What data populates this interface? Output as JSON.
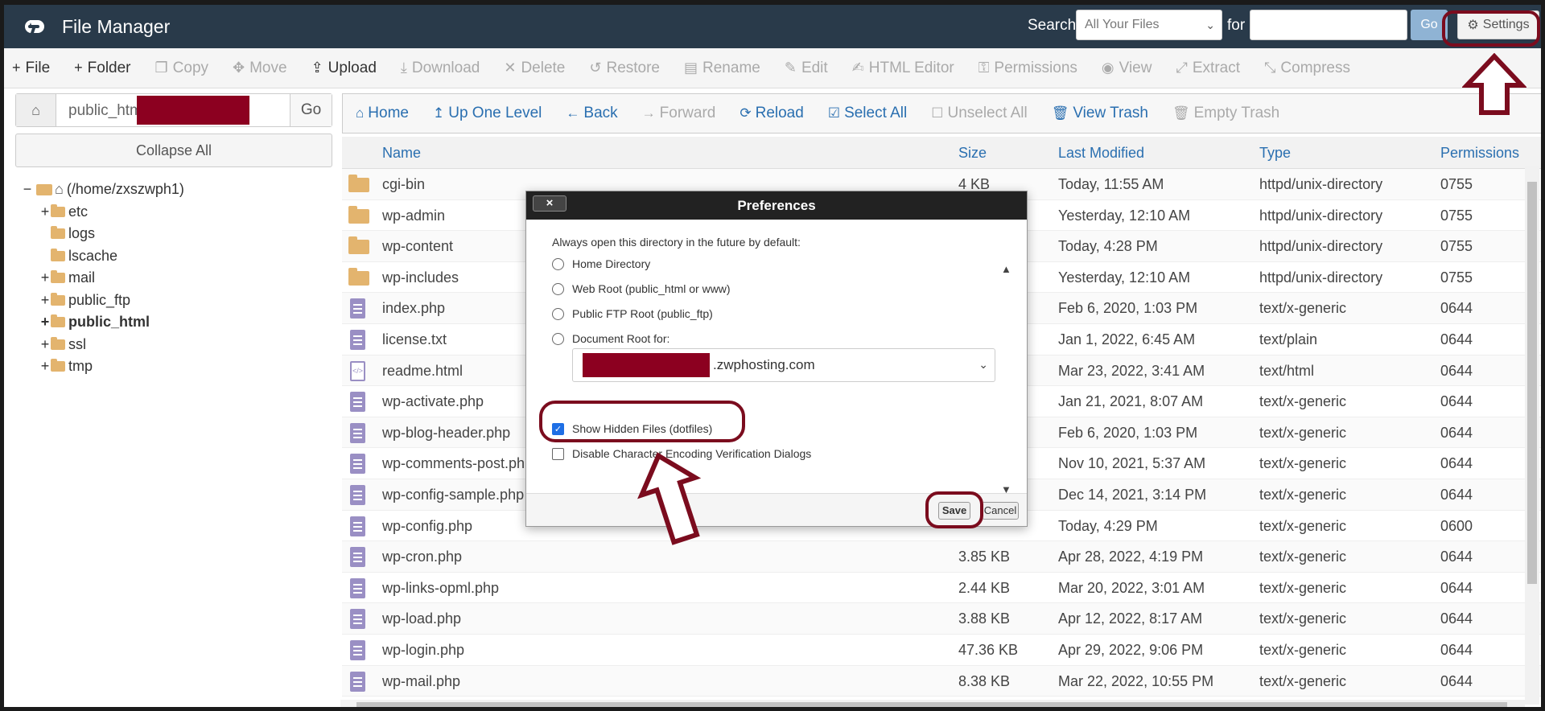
{
  "header": {
    "app_title": "File Manager",
    "search_label": "Search",
    "search_scope": "All Your Files",
    "for_label": "for",
    "search_value": "",
    "go_label": "Go",
    "settings_label": "Settings"
  },
  "toolbar": {
    "items": [
      {
        "label": "File",
        "icon": "plus-icon",
        "disabled": false
      },
      {
        "label": "Folder",
        "icon": "plus-icon",
        "disabled": false
      },
      {
        "label": "Copy",
        "icon": "copy-icon",
        "disabled": true
      },
      {
        "label": "Move",
        "icon": "move-icon",
        "disabled": true
      },
      {
        "label": "Upload",
        "icon": "upload-icon",
        "disabled": false
      },
      {
        "label": "Download",
        "icon": "download-icon",
        "disabled": true
      },
      {
        "label": "Delete",
        "icon": "x-icon",
        "disabled": true
      },
      {
        "label": "Restore",
        "icon": "restore-icon",
        "disabled": true
      },
      {
        "label": "Rename",
        "icon": "file-icon",
        "disabled": true
      },
      {
        "label": "Edit",
        "icon": "pencil-icon",
        "disabled": true
      },
      {
        "label": "HTML Editor",
        "icon": "edit-icon",
        "disabled": true
      },
      {
        "label": "Permissions",
        "icon": "key-icon",
        "disabled": true
      },
      {
        "label": "View",
        "icon": "eye-icon",
        "disabled": true
      },
      {
        "label": "Extract",
        "icon": "expand-icon",
        "disabled": true
      },
      {
        "label": "Compress",
        "icon": "compress-icon",
        "disabled": true
      }
    ]
  },
  "left": {
    "path_prefix": "public_html/",
    "go_label": "Go",
    "collapse_label": "Collapse All",
    "root_label": "(/home/zxszwph1)",
    "tree": [
      {
        "label": "etc",
        "toggle": "+",
        "bold": false
      },
      {
        "label": "logs",
        "toggle": "",
        "bold": false
      },
      {
        "label": "lscache",
        "toggle": "",
        "bold": false
      },
      {
        "label": "mail",
        "toggle": "+",
        "bold": false
      },
      {
        "label": "public_ftp",
        "toggle": "+",
        "bold": false
      },
      {
        "label": "public_html",
        "toggle": "+",
        "bold": true
      },
      {
        "label": "ssl",
        "toggle": "+",
        "bold": false
      },
      {
        "label": "tmp",
        "toggle": "+",
        "bold": false
      }
    ]
  },
  "nav": {
    "items": [
      {
        "label": "Home",
        "icon": "home-icon",
        "disabled": false
      },
      {
        "label": "Up One Level",
        "icon": "level-up-icon",
        "disabled": false
      },
      {
        "label": "Back",
        "icon": "arrow-left-icon",
        "disabled": false
      },
      {
        "label": "Forward",
        "icon": "arrow-right-icon",
        "disabled": true
      },
      {
        "label": "Reload",
        "icon": "reload-icon",
        "disabled": false
      },
      {
        "label": "Select All",
        "icon": "checkbox-checked-icon",
        "disabled": false
      },
      {
        "label": "Unselect All",
        "icon": "checkbox-empty-icon",
        "disabled": true
      },
      {
        "label": "View Trash",
        "icon": "trash-icon",
        "disabled": false
      },
      {
        "label": "Empty Trash",
        "icon": "trash-icon",
        "disabled": true
      }
    ]
  },
  "table": {
    "columns": [
      "Name",
      "Size",
      "Last Modified",
      "Type",
      "Permissions"
    ],
    "rows": [
      {
        "name": "cgi-bin",
        "size": "4 KB",
        "modified": "Today, 11:55 AM",
        "type": "httpd/unix-directory",
        "perm": "0755",
        "kind": "folder"
      },
      {
        "name": "wp-admin",
        "size": "",
        "modified": "Yesterday, 12:10 AM",
        "type": "httpd/unix-directory",
        "perm": "0755",
        "kind": "folder"
      },
      {
        "name": "wp-content",
        "size": "",
        "modified": "Today, 4:28 PM",
        "type": "httpd/unix-directory",
        "perm": "0755",
        "kind": "folder"
      },
      {
        "name": "wp-includes",
        "size": "",
        "modified": "Yesterday, 12:10 AM",
        "type": "httpd/unix-directory",
        "perm": "0755",
        "kind": "folder"
      },
      {
        "name": "index.php",
        "size": "",
        "modified": "Feb 6, 2020, 1:03 PM",
        "type": "text/x-generic",
        "perm": "0644",
        "kind": "file"
      },
      {
        "name": "license.txt",
        "size": "",
        "modified": "Jan 1, 2022, 6:45 AM",
        "type": "text/plain",
        "perm": "0644",
        "kind": "file"
      },
      {
        "name": "readme.html",
        "size": "",
        "modified": "Mar 23, 2022, 3:41 AM",
        "type": "text/html",
        "perm": "0644",
        "kind": "html"
      },
      {
        "name": "wp-activate.php",
        "size": "",
        "modified": "Jan 21, 2021, 8:07 AM",
        "type": "text/x-generic",
        "perm": "0644",
        "kind": "file"
      },
      {
        "name": "wp-blog-header.php",
        "size": "",
        "modified": "Feb 6, 2020, 1:03 PM",
        "type": "text/x-generic",
        "perm": "0644",
        "kind": "file"
      },
      {
        "name": "wp-comments-post.php",
        "size": "",
        "modified": "Nov 10, 2021, 5:37 AM",
        "type": "text/x-generic",
        "perm": "0644",
        "kind": "file"
      },
      {
        "name": "wp-config-sample.php",
        "size": "",
        "modified": "Dec 14, 2021, 3:14 PM",
        "type": "text/x-generic",
        "perm": "0644",
        "kind": "file"
      },
      {
        "name": "wp-config.php",
        "size": "",
        "modified": "Today, 4:29 PM",
        "type": "text/x-generic",
        "perm": "0600",
        "kind": "file"
      },
      {
        "name": "wp-cron.php",
        "size": "3.85 KB",
        "modified": "Apr 28, 2022, 4:19 PM",
        "type": "text/x-generic",
        "perm": "0644",
        "kind": "file"
      },
      {
        "name": "wp-links-opml.php",
        "size": "2.44 KB",
        "modified": "Mar 20, 2022, 3:01 AM",
        "type": "text/x-generic",
        "perm": "0644",
        "kind": "file"
      },
      {
        "name": "wp-load.php",
        "size": "3.88 KB",
        "modified": "Apr 12, 2022, 8:17 AM",
        "type": "text/x-generic",
        "perm": "0644",
        "kind": "file"
      },
      {
        "name": "wp-login.php",
        "size": "47.36 KB",
        "modified": "Apr 29, 2022, 9:06 PM",
        "type": "text/x-generic",
        "perm": "0644",
        "kind": "file"
      },
      {
        "name": "wp-mail.php",
        "size": "8.38 KB",
        "modified": "Mar 22, 2022, 10:55 PM",
        "type": "text/x-generic",
        "perm": "0644",
        "kind": "file"
      }
    ]
  },
  "dialog": {
    "title": "Preferences",
    "close_label": "×",
    "intro": "Always open this directory in the future by default:",
    "options": [
      "Home Directory",
      "Web Root (public_html or www)",
      "Public FTP Root (public_ftp)",
      "Document Root for:"
    ],
    "docroot_domain": ".zwphosting.com",
    "show_hidden": "Show Hidden Files (dotfiles)",
    "show_hidden_checked": true,
    "disable_encoding": "Disable Character Encoding Verification Dialogs",
    "disable_encoding_checked": false,
    "save_label": "Save",
    "cancel_label": "Cancel"
  },
  "colors": {
    "header_bg": "#293a4a",
    "link": "#2a6fb0",
    "annotation": "#7b0c1e",
    "redaction": "#8c0020"
  }
}
